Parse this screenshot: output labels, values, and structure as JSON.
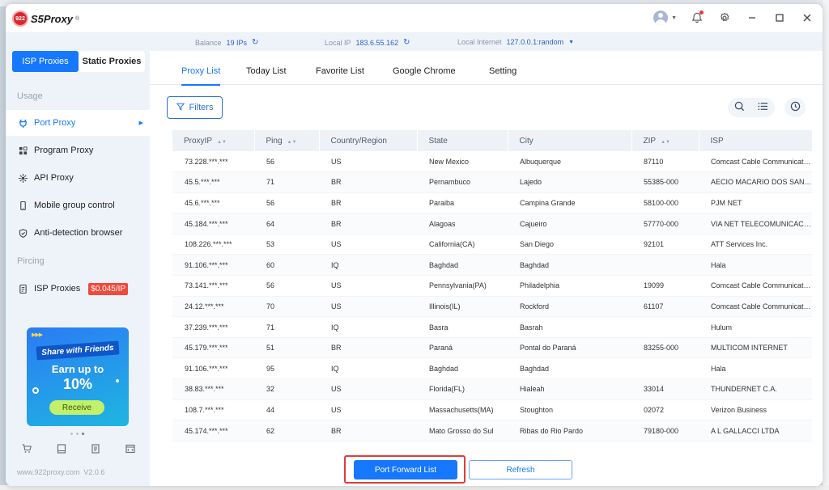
{
  "app": {
    "logo_text": "S5Proxy",
    "logo_badge": "922"
  },
  "sidebar": {
    "tabs": [
      "ISP Proxies",
      "Static Proxies"
    ],
    "section_usage": "Usage",
    "items": [
      {
        "label": "Port Proxy",
        "icon": "plug-icon"
      },
      {
        "label": "Program Proxy",
        "icon": "grid-icon"
      },
      {
        "label": "API Proxy",
        "icon": "api-icon"
      },
      {
        "label": "Mobile group control",
        "icon": "mobile-icon"
      },
      {
        "label": "Anti-detection browser",
        "icon": "shield-icon"
      }
    ],
    "section_pricing": "Pircing",
    "pricing_item": {
      "label": "ISP Proxies",
      "badge": "$0.045/IP"
    },
    "promo": {
      "share": "Share with Friends",
      "earn": "Earn up to",
      "percent": "10%",
      "button": "Receive"
    },
    "footer": {
      "site": "www.922proxy.com",
      "version": "V2.0.6"
    }
  },
  "infobar": {
    "balance_label": "Balance",
    "balance_value": "19 IPs",
    "local_ip_label": "Local IP",
    "local_ip_value": "183.6.55.162",
    "local_internet_label": "Local Internet",
    "local_internet_value": "127.0.0.1:random"
  },
  "tabs": [
    "Proxy List",
    "Today List",
    "Favorite List",
    "Google Chrome",
    "Setting"
  ],
  "filters_label": "Filters",
  "table": {
    "columns": [
      "ProxyIP",
      "Ping",
      "Country/Region",
      "State",
      "City",
      "ZIP",
      "ISP"
    ],
    "rows": [
      [
        "73.228.***.***",
        "56",
        "US",
        "New Mexico",
        "Albuquerque",
        "87110",
        "Comcast Cable Communications"
      ],
      [
        "45.5.***.***",
        "71",
        "BR",
        "Pernambuco",
        "Lajedo",
        "55385-000",
        "AECIO MACARIO DOS SANTOS"
      ],
      [
        "45.6.***.***",
        "56",
        "BR",
        "Paraiba",
        "Campina Grande",
        "58100-000",
        "PJM NET"
      ],
      [
        "45.184.***.***",
        "64",
        "BR",
        "Alagoas",
        "Cajueiro",
        "57770-000",
        "VIA NET TELECOMUNICACOES"
      ],
      [
        "108.226.***.***",
        "53",
        "US",
        "California(CA)",
        "San Diego",
        "92101",
        "ATT Services Inc."
      ],
      [
        "91.106.***.***",
        "60",
        "IQ",
        "Baghdad",
        "Baghdad",
        "",
        "Hala"
      ],
      [
        "73.141.***.***",
        "56",
        "US",
        "Pennsylvania(PA)",
        "Philadelphia",
        "19099",
        "Comcast Cable Communications"
      ],
      [
        "24.12.***.***",
        "70",
        "US",
        "Illinois(IL)",
        "Rockford",
        "61107",
        "Comcast Cable Communications"
      ],
      [
        "37.239.***.***",
        "71",
        "IQ",
        "Basra",
        "Basrah",
        "",
        "Hulum"
      ],
      [
        "45.179.***.***",
        "51",
        "BR",
        "Paraná",
        "Pontal do Paraná",
        "83255-000",
        "MULTICOM INTERNET"
      ],
      [
        "91.106.***.***",
        "95",
        "IQ",
        "Baghdad",
        "Baghdad",
        "",
        "Hala"
      ],
      [
        "38.83.***.***",
        "32",
        "US",
        "Florida(FL)",
        "Hialeah",
        "33014",
        "THUNDERNET C.A."
      ],
      [
        "108.7.***.***",
        "44",
        "US",
        "Massachusetts(MA)",
        "Stoughton",
        "02072",
        "Verizon Business"
      ],
      [
        "45.174.***.***",
        "62",
        "BR",
        "Mato Grosso do Sul",
        "Ribas do Rio Pardo",
        "79180-000",
        "A L GALLACCI LTDA"
      ]
    ]
  },
  "buttons": {
    "port_forward": "Port Forward List",
    "refresh": "Refresh"
  },
  "colors": {
    "accent": "#1677ff",
    "badge": "#f04a3c",
    "highlight": "#e23b3b"
  }
}
